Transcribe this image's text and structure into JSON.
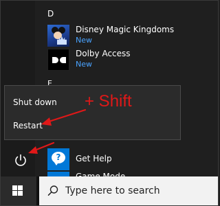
{
  "start_menu": {
    "section_d_letter": "D",
    "section_e_letter": "E",
    "apps": [
      {
        "name": "Disney Magic Kingdoms",
        "badge": "New",
        "icon": "disney-magic-kingdoms-icon"
      },
      {
        "name": "Dolby Access",
        "badge": "New",
        "icon": "dolby-icon"
      },
      {
        "name": "Get Help",
        "badge": "",
        "icon": "get-help-icon"
      },
      {
        "name": "Game Mode",
        "badge": "",
        "icon": "game-mode-icon"
      }
    ]
  },
  "power_menu": {
    "items": [
      {
        "label": "Shut down"
      },
      {
        "label": "Restart"
      }
    ]
  },
  "annotation": {
    "text": "+ Shift",
    "color": "#e01818"
  },
  "taskbar": {
    "search_placeholder": "Type here to search"
  },
  "colors": {
    "accent": "#0078d7",
    "badge": "#4aa3ff",
    "background": "#1f1f1f"
  }
}
